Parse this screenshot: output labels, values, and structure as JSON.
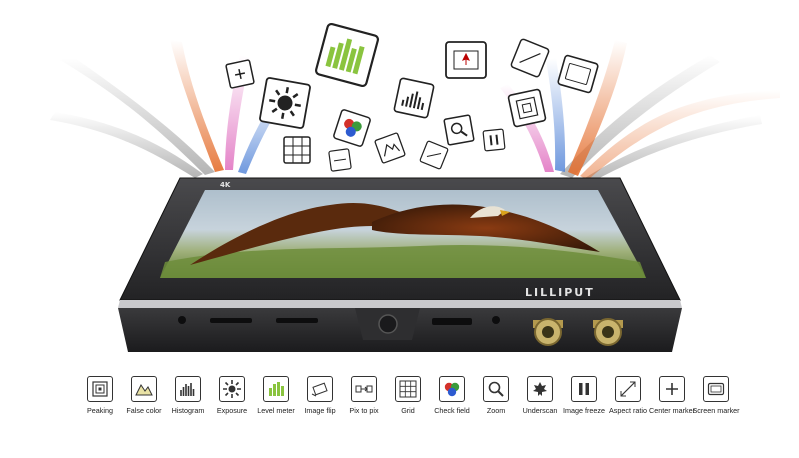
{
  "brand": "LILLIPUT",
  "badge": "4K",
  "colors": {
    "bezel": "#3a3a3c",
    "bezel_dark": "#1e1e20",
    "chrome": "#c9c9cc",
    "sky_top": "#c7d3dc",
    "grass": "#6d8d3b",
    "accent_warm": "#e46d2c",
    "accent_cool": "#4b7fd6",
    "accent_pink": "#d94fb1"
  },
  "tools": [
    {
      "label": "Peaking",
      "icon": "peaking-icon"
    },
    {
      "label": "False color",
      "icon": "false-color-icon"
    },
    {
      "label": "Histogram",
      "icon": "histogram-icon"
    },
    {
      "label": "Exposure",
      "icon": "exposure-icon"
    },
    {
      "label": "Level meter",
      "icon": "level-meter-icon"
    },
    {
      "label": "Image flip",
      "icon": "image-flip-icon"
    },
    {
      "label": "Pix to pix",
      "icon": "pix-to-pix-icon"
    },
    {
      "label": "Grid",
      "icon": "grid-icon"
    },
    {
      "label": "Check field",
      "icon": "check-field-icon"
    },
    {
      "label": "Zoom",
      "icon": "zoom-icon"
    },
    {
      "label": "Underscan",
      "icon": "underscan-icon"
    },
    {
      "label": "Image freeze",
      "icon": "image-freeze-icon"
    },
    {
      "label": "Aspect ratio",
      "icon": "aspect-ratio-icon"
    },
    {
      "label": "Center marker",
      "icon": "center-marker-icon"
    },
    {
      "label": "Screen marker",
      "icon": "screen-marker-icon"
    }
  ]
}
